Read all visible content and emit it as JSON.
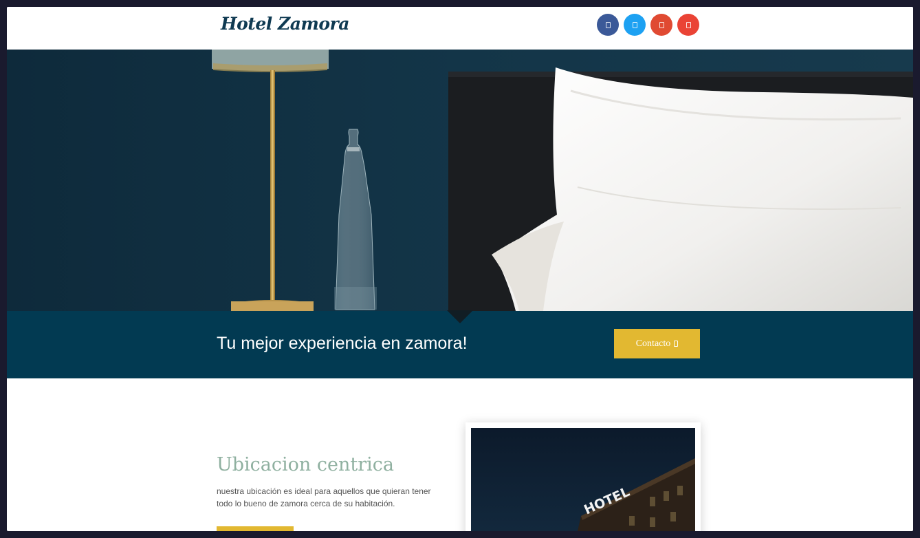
{
  "header": {
    "logo_text": "Hotel Zamora",
    "socials": [
      {
        "name": "facebook",
        "color": "#3b5998"
      },
      {
        "name": "twitter",
        "color": "#1da1f2"
      },
      {
        "name": "instagram",
        "color": "#e04a32"
      },
      {
        "name": "google-plus",
        "color": "#ea4335"
      }
    ]
  },
  "banner": {
    "title": "Tu mejor experiencia en zamora!",
    "button_label": "Contacto"
  },
  "colors": {
    "brand_dark": "#023a52",
    "accent": "#e2b831",
    "section_title": "#8fb0a0"
  },
  "section": {
    "title": "Ubicacion centrica",
    "text_line1": "nuestra ubicación es ideal para aquellos que quieran tener",
    "text_line2": "todo lo bueno de zamora cerca de su habitación.",
    "image_sign": "HOTEL"
  }
}
